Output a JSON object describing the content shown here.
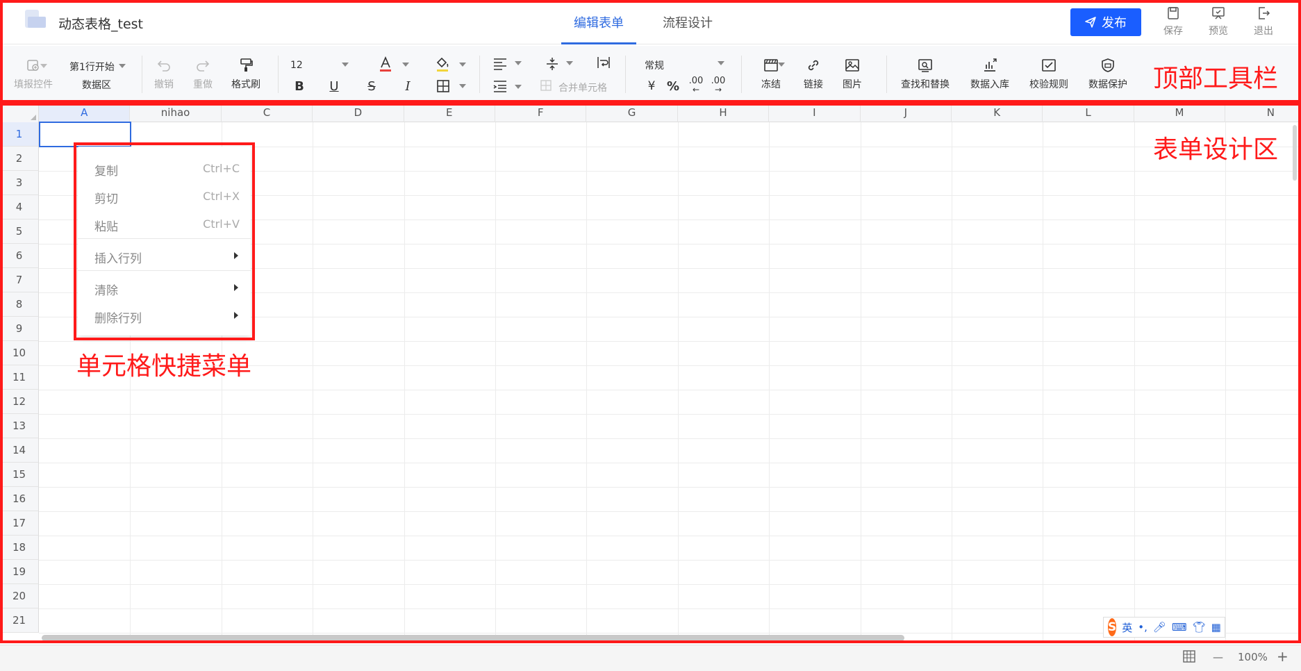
{
  "header": {
    "title": "动态表格_test",
    "tabs": [
      {
        "label": "编辑表单"
      },
      {
        "label": "流程设计"
      }
    ],
    "publish_label": "发布",
    "save_label": "保存",
    "preview_label": "预览",
    "exit_label": "退出"
  },
  "toolbar": {
    "fill_control": "填报控件",
    "start_row": "第1行开始",
    "data_area": "数据区",
    "undo": "撤销",
    "redo": "重做",
    "format_painter": "格式刷",
    "font_size": "12",
    "bold": "B",
    "underline": "U",
    "strike": "S",
    "italic": "I",
    "merge_cells": "合并单元格",
    "number_format": "常规",
    "currency": "¥",
    "percent": "%",
    "dec_inc": ".00",
    "dec_dec": ".00",
    "freeze": "冻结",
    "link": "链接",
    "image": "图片",
    "find_replace": "查找和替换",
    "data_import": "数据入库",
    "validation": "校验规则",
    "data_protect": "数据保护",
    "font_color": "#e8413c",
    "fill_color": "#f2d53c"
  },
  "sheet": {
    "columns": [
      "A",
      "nihao",
      "C",
      "D",
      "E",
      "F",
      "G",
      "H",
      "I",
      "J",
      "K",
      "L",
      "M",
      "N"
    ],
    "rows": [
      "1",
      "2",
      "3",
      "4",
      "5",
      "6",
      "7",
      "8",
      "9",
      "10",
      "11",
      "12",
      "13",
      "14",
      "15",
      "16",
      "17",
      "18",
      "19",
      "20",
      "21"
    ]
  },
  "context_menu": {
    "copy": "复制",
    "copy_shortcut": "Ctrl+C",
    "cut": "剪切",
    "cut_shortcut": "Ctrl+X",
    "paste": "粘贴",
    "paste_shortcut": "Ctrl+V",
    "insert": "插入行列",
    "clear": "清除",
    "delete": "删除行列"
  },
  "annotations": {
    "toolbar": "顶部工具栏",
    "design_area": "表单设计区",
    "menu": "单元格快捷菜单"
  },
  "ime": {
    "lang": "英"
  },
  "footer": {
    "zoom": "100%",
    "minus": "—",
    "plus": "+"
  },
  "colors": {
    "accent": "#2f6be0",
    "publish": "#1a5eff",
    "annotation": "#ff1a1a"
  }
}
